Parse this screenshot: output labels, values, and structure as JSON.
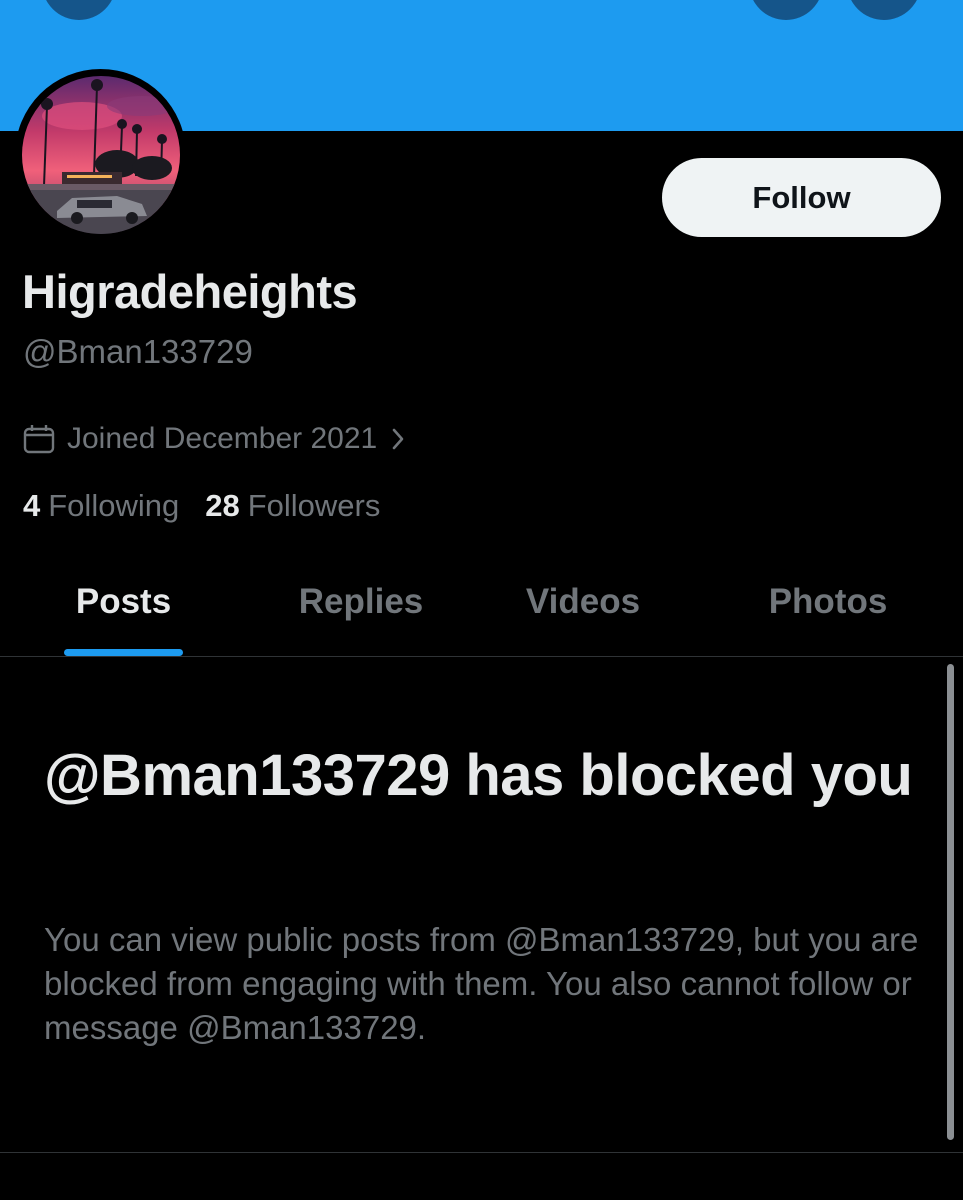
{
  "profile": {
    "display_name": "Higradeheights",
    "handle": "@Bman133729",
    "joined": "Joined December 2021",
    "following_count": "4",
    "following_label": "Following",
    "followers_count": "28",
    "followers_label": "Followers"
  },
  "actions": {
    "follow_label": "Follow"
  },
  "tabs": [
    {
      "label": "Posts",
      "active": true
    },
    {
      "label": "Replies",
      "active": false
    },
    {
      "label": "Videos",
      "active": false
    },
    {
      "label": "Photos",
      "active": false
    }
  ],
  "blocked_notice": {
    "title": "@Bman133729 has blocked you",
    "body": "You can view public posts from @Bman133729, but you are blocked from engaging with them. You also cannot follow or message @Bman133729."
  },
  "icons": {
    "joined": "calendar-icon",
    "joined_more": "chevron-right-icon"
  },
  "colors": {
    "banner": "#1d9bf0",
    "accent": "#1d9bf0",
    "background": "#000000",
    "primary_text": "#e7e9ea",
    "secondary_text": "#71767b",
    "follow_button_bg": "#eff3f4"
  }
}
